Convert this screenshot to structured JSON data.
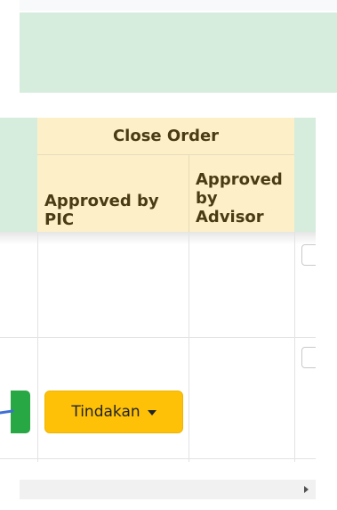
{
  "table": {
    "group_header": "Close Order",
    "columns": [
      {
        "line1": "Approved by",
        "line2": "PIC"
      },
      {
        "line1": "Approved",
        "line2": "by",
        "line3": "Advisor"
      }
    ],
    "rows": [
      {
        "action": ""
      },
      {
        "action": "Tindakan"
      }
    ]
  },
  "colors": {
    "header_green": "#d6ecdc",
    "header_yellow": "#fdf0c8",
    "action_button": "#ffc107",
    "success_button": "#28a745"
  },
  "icons": {
    "dropdown_caret": "caret-down-icon",
    "scroll_right": "arrow-right-icon"
  }
}
